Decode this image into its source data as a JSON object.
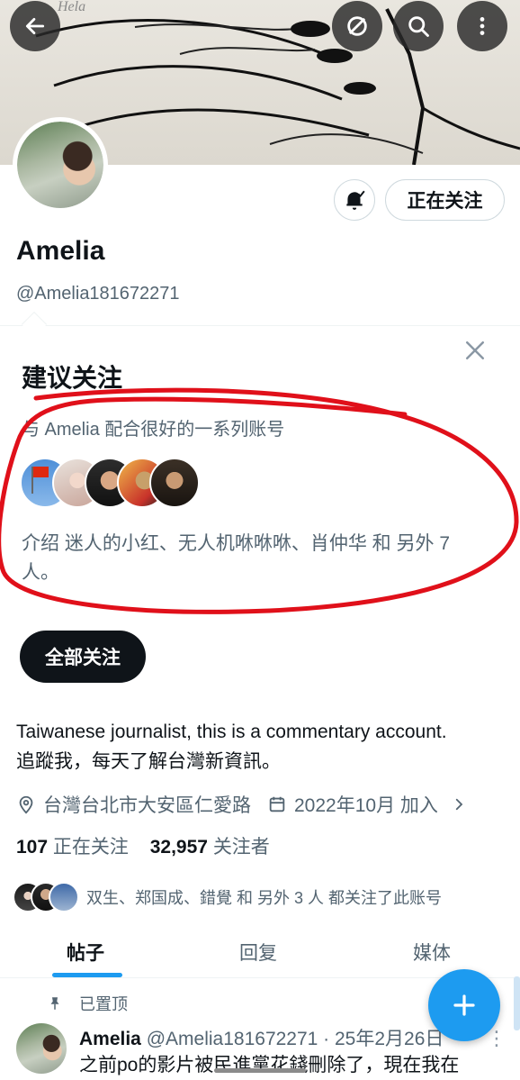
{
  "banner": {
    "back_icon": "arrow-left-icon",
    "sync_icon": "circle-slash-icon",
    "search_icon": "search-icon",
    "more_icon": "vertical-dots-icon",
    "sketch_text": "Hela"
  },
  "profile": {
    "name": "Amelia",
    "handle": "@Amelia181672271",
    "following_button": "正在关注",
    "bell_icon": "bell-check-icon"
  },
  "suggestions": {
    "title": "建议关注",
    "subtitle": "与 Amelia 配合很好的一系列账号",
    "description": "介绍 迷人的小红、无人机咻咻咻、肖仲华 和 另外 7 人。",
    "follow_all_label": "全部关注",
    "close_icon": "close-icon"
  },
  "bio": {
    "line1": "Taiwanese journalist, this is a commentary account.",
    "line2": "追蹤我，每天了解台灣新資訊。"
  },
  "meta": {
    "location": "台灣台北市大安區仁愛路",
    "joined": "2022年10月 加入",
    "location_icon": "location-pin-icon",
    "calendar_icon": "calendar-icon"
  },
  "stats": {
    "following_count": "107",
    "following_label": "正在关注",
    "followers_count": "32,957",
    "followers_label": "关注者"
  },
  "followed_by": {
    "text": "双生、郑国成、錯覺 和 另外 3 人 都关注了此账号"
  },
  "tabs": [
    {
      "label": "帖子",
      "active": true
    },
    {
      "label": "回复",
      "active": false
    },
    {
      "label": "媒体",
      "active": false
    }
  ],
  "post": {
    "pinned_label": "已置顶",
    "author": "Amelia",
    "handle_date": "@Amelia181672271 · 25年2月26日",
    "snippet": "之前po的影片被民進黨花錢刪除了，現在我在",
    "more_icon": "vertical-dots-icon"
  },
  "fab": {
    "icon": "plus-icon"
  },
  "colors": {
    "accent": "#1d9bf0",
    "text_primary": "#0f1419",
    "text_secondary": "#536471",
    "annotation": "#e0101a"
  }
}
